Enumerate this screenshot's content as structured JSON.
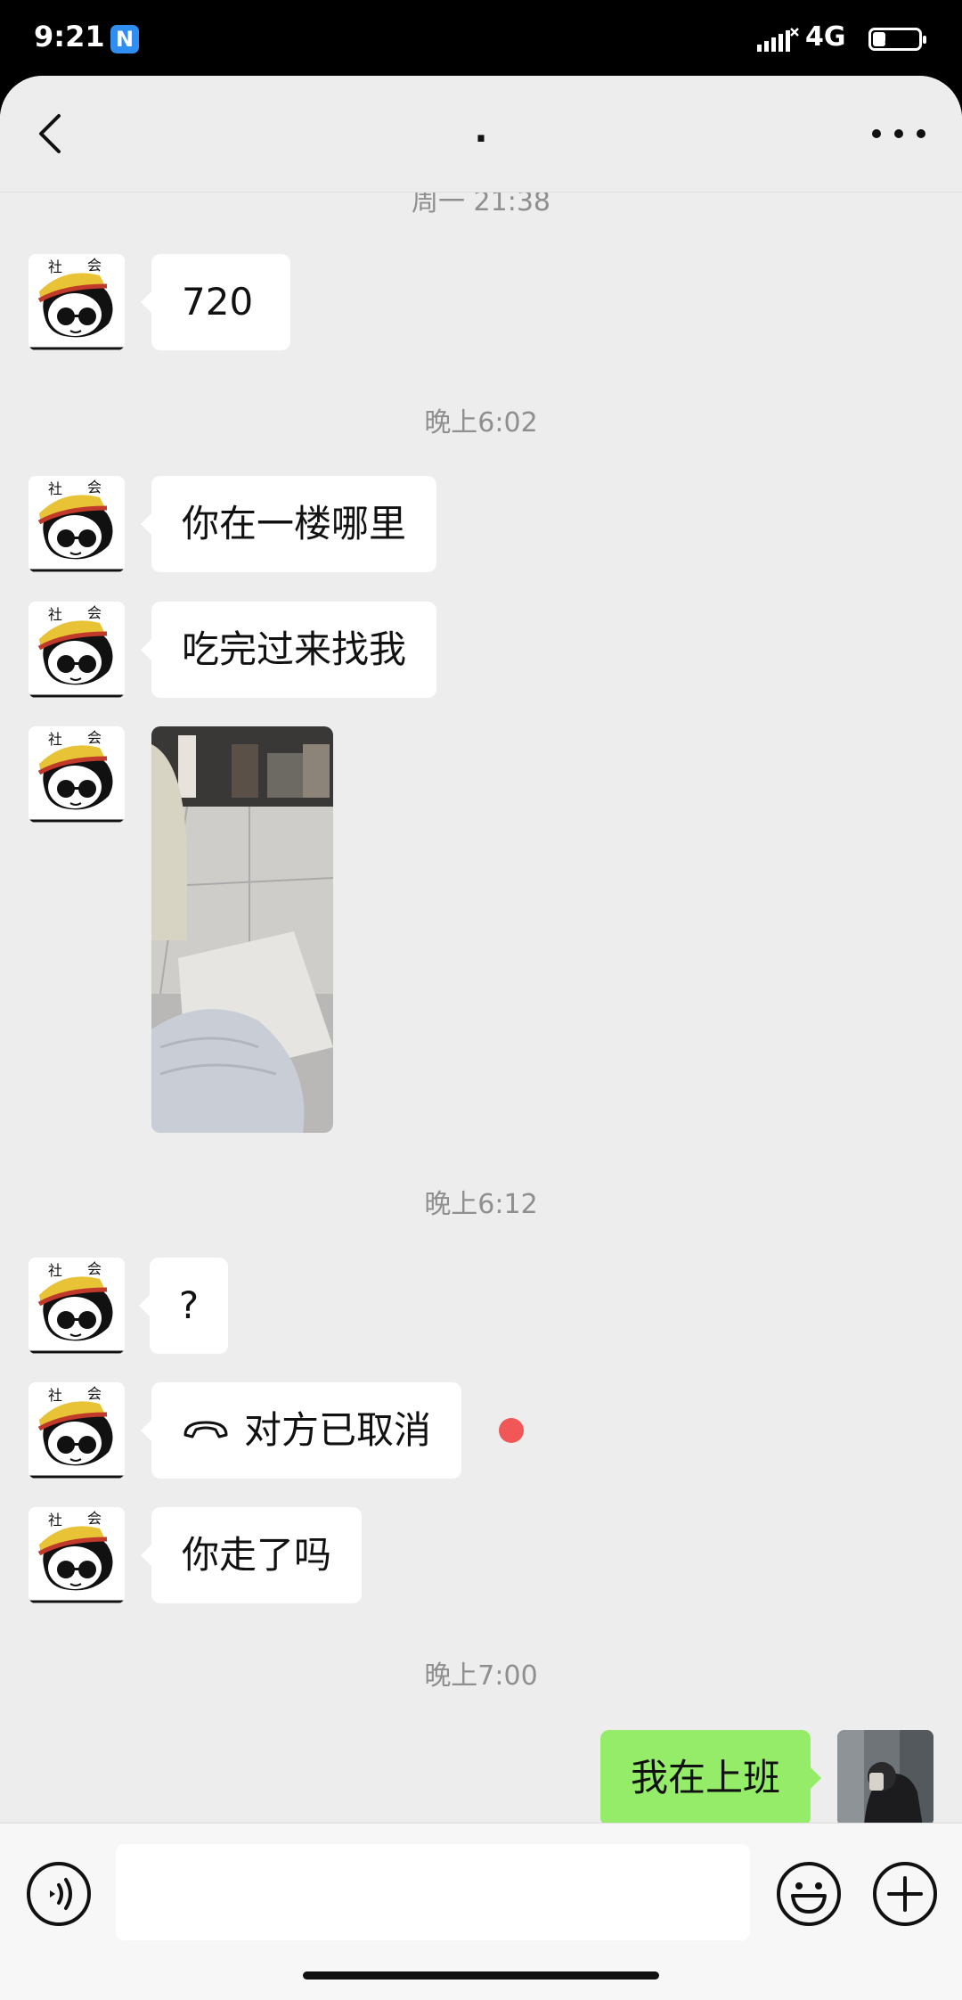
{
  "status_bar": {
    "time": "9:21",
    "app_badge": "N",
    "network": "4G",
    "battery": "33",
    "battery_level": 0.33
  },
  "header": {
    "title": ".",
    "back_icon": "chevron-left-icon",
    "more_icon": "ellipsis-icon"
  },
  "messages": {
    "partial_timestamp": "周一 21:38",
    "m1": "720",
    "ts2": "晚上6:02",
    "m2": "你在一楼哪里",
    "m3": "吃完过来找我",
    "ts3": "晚上6:12",
    "m4": "?",
    "m5": "对方已取消",
    "m6": "你走了吗",
    "ts4": "晚上7:00",
    "m7": "我在上班"
  },
  "avatar_badge": {
    "left": "社",
    "right": "会"
  },
  "input": {
    "placeholder": ""
  },
  "colors": {
    "background": "#ededed",
    "bubble_incoming": "#ffffff",
    "bubble_outgoing": "#95ec69",
    "unread_dot": "#f25757"
  }
}
